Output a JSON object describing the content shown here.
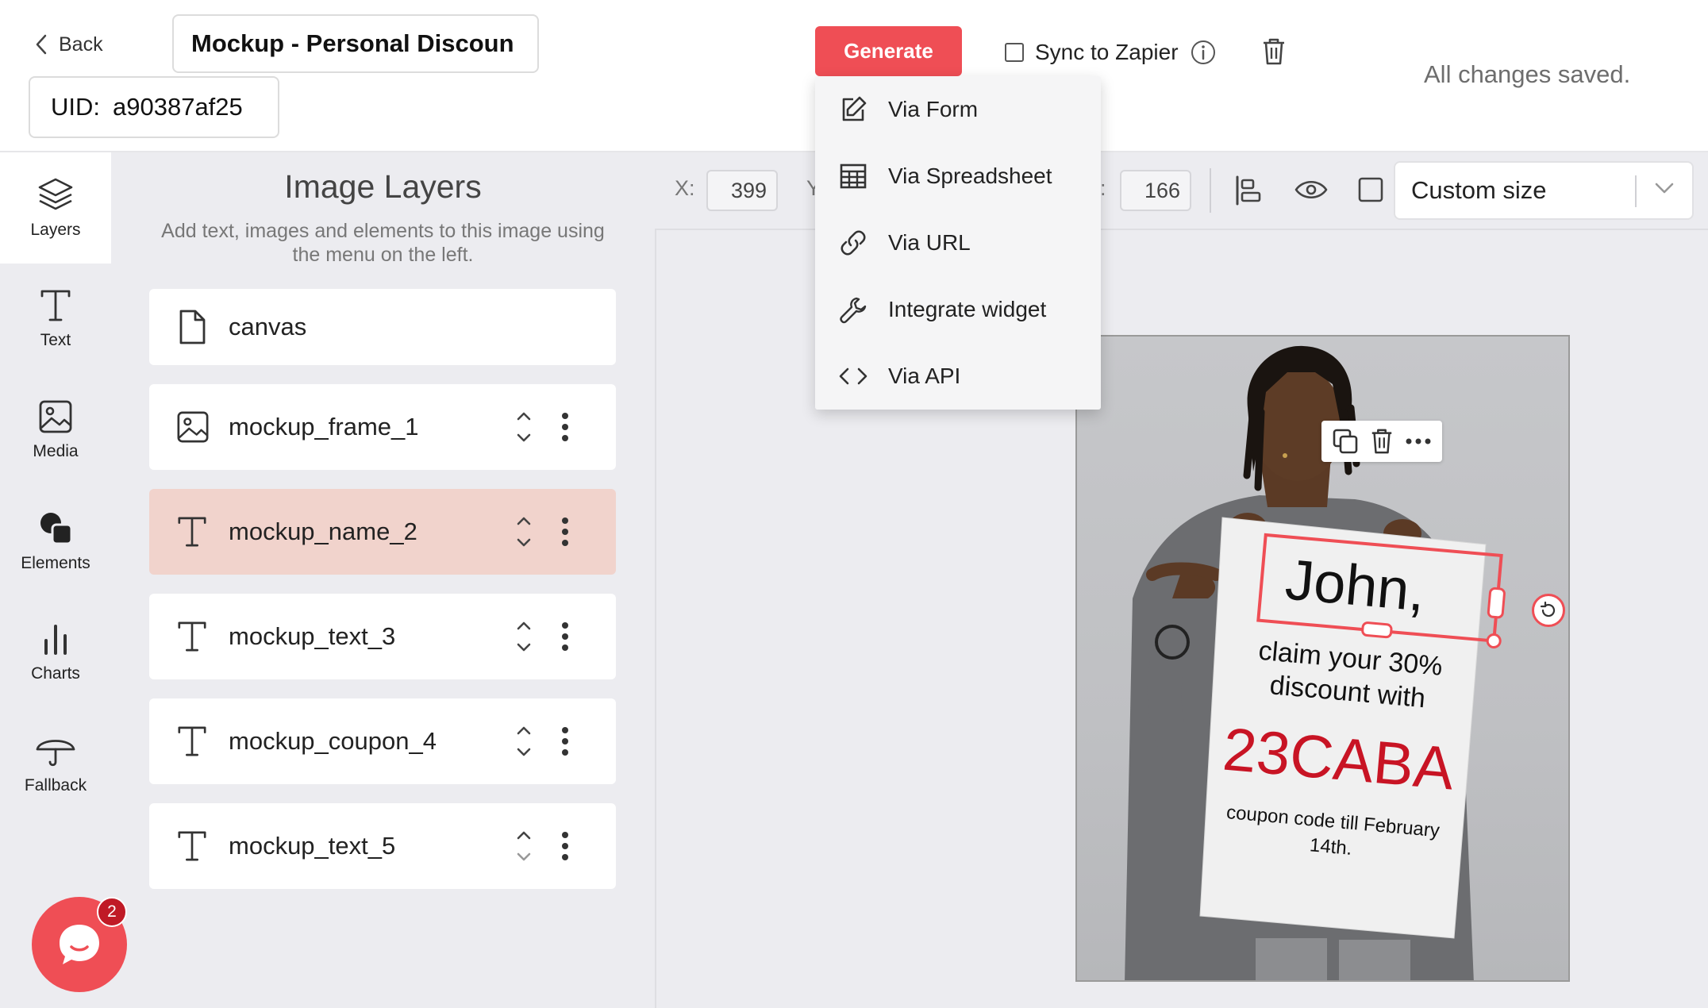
{
  "header": {
    "back_label": "Back",
    "title": "Mockup - Personal Discoun",
    "uid_label": "UID:",
    "uid_value": "a90387af25",
    "generate_label": "Generate",
    "zapier_label": "Sync to Zapier",
    "zapier_checked": false,
    "save_status": "All changes saved."
  },
  "generate_menu": {
    "items": [
      {
        "label": "Via Form",
        "icon": "edit-icon"
      },
      {
        "label": "Via Spreadsheet",
        "icon": "table-icon"
      },
      {
        "label": "Via URL",
        "icon": "link-icon"
      },
      {
        "label": "Integrate widget",
        "icon": "wrench-icon"
      },
      {
        "label": "Via API",
        "icon": "code-icon"
      }
    ]
  },
  "sidebar": {
    "items": [
      {
        "label": "Layers",
        "icon": "layers-icon",
        "active": true
      },
      {
        "label": "Text",
        "icon": "text-icon"
      },
      {
        "label": "Media",
        "icon": "image-icon"
      },
      {
        "label": "Elements",
        "icon": "shapes-icon"
      },
      {
        "label": "Charts",
        "icon": "bar-chart-icon"
      },
      {
        "label": "Fallback",
        "icon": "umbrella-icon"
      }
    ]
  },
  "layers_panel": {
    "title": "Image Layers",
    "hint": "Add text, images and elements to this image using the menu on the left.",
    "layers": [
      {
        "name": "canvas",
        "icon": "file-icon"
      },
      {
        "name": "mockup_frame_1",
        "icon": "image-icon"
      },
      {
        "name": "mockup_name_2",
        "icon": "text-icon",
        "selected": true
      },
      {
        "name": "mockup_text_3",
        "icon": "text-icon"
      },
      {
        "name": "mockup_coupon_4",
        "icon": "text-icon"
      },
      {
        "name": "mockup_text_5",
        "icon": "text-icon"
      }
    ]
  },
  "toolbar": {
    "x_label": "X:",
    "x_value": "399",
    "y_label": "Y",
    "h_label": ":",
    "h_value": "166",
    "size_select": "Custom size"
  },
  "canvas": {
    "sign": {
      "name": "John,",
      "line1": "claim your 30%",
      "line2": "discount with",
      "coupon": "23CABA",
      "footer1": "coupon code till February",
      "footer2": "14th."
    },
    "coupon_color": "#c81424",
    "selection_color": "#ef4e55"
  },
  "chat": {
    "badge_count": "2"
  },
  "colors": {
    "accent": "#ef4e55",
    "selected_layer_bg": "#f1d3cc",
    "panel_bg": "#ececf0"
  }
}
